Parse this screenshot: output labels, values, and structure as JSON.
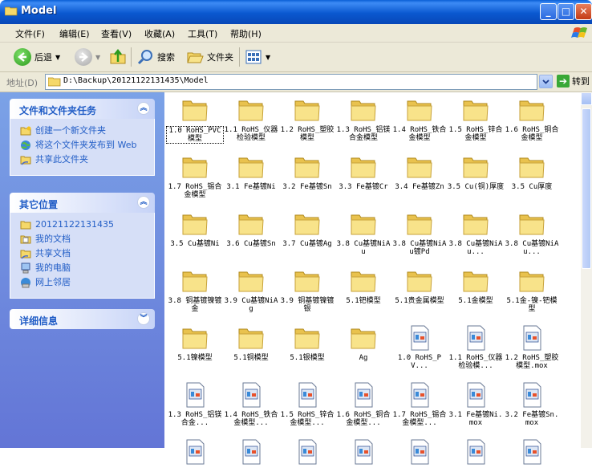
{
  "window": {
    "title": "Model"
  },
  "menu": {
    "items": [
      "文件(F)",
      "编辑(E)",
      "查看(V)",
      "收藏(A)",
      "工具(T)",
      "帮助(H)"
    ]
  },
  "toolbar": {
    "back_label": "后退",
    "search_label": "搜索",
    "folders_label": "文件夹"
  },
  "address": {
    "label": "地址(D)",
    "value": "D:\\Backup\\20121122131435\\Model",
    "goto_label": "转到"
  },
  "tasks_panel": {
    "title": "文件和文件夹任务",
    "items": [
      "创建一个新文件夹",
      "将这个文件夹发布到 Web",
      "共享此文件夹"
    ]
  },
  "places_panel": {
    "title": "其它位置",
    "items": [
      "20121122131435",
      "我的文档",
      "共享文档",
      "我的电脑",
      "网上邻居"
    ]
  },
  "details_panel": {
    "title": "详细信息"
  },
  "files": [
    {
      "label": "1.0 RoHS_PVC模型",
      "type": "folder"
    },
    {
      "label": "1.1 RoHS_仪器检验模型",
      "type": "folder"
    },
    {
      "label": "1.2 RoHS_塑胶模型",
      "type": "folder"
    },
    {
      "label": "1.3 RoHS_铝镁合金模型",
      "type": "folder"
    },
    {
      "label": "1.4 RoHS_铁合金模型",
      "type": "folder"
    },
    {
      "label": "1.5 RoHS_锌合金模型",
      "type": "folder"
    },
    {
      "label": "1.6 RoHS_铜合金模型",
      "type": "folder"
    },
    {
      "label": "1.7 RoHS_锡合金模型",
      "type": "folder"
    },
    {
      "label": "3.1 Fe基镀Ni",
      "type": "folder"
    },
    {
      "label": "3.2 Fe基镀Sn",
      "type": "folder"
    },
    {
      "label": "3.3 Fe基镀Cr",
      "type": "folder"
    },
    {
      "label": "3.4 Fe基镀Zn",
      "type": "folder"
    },
    {
      "label": "3.5 Cu(铜)厚度",
      "type": "folder"
    },
    {
      "label": "3.5 Cu厚度",
      "type": "folder"
    },
    {
      "label": "3.5 Cu基镀Ni",
      "type": "folder"
    },
    {
      "label": "3.6 Cu基镀Sn",
      "type": "folder"
    },
    {
      "label": "3.7 Cu基镀Ag",
      "type": "folder"
    },
    {
      "label": "3.8 Cu基镀NiAu",
      "type": "folder"
    },
    {
      "label": "3.8 Cu基镀NiAu镀Pd",
      "type": "folder"
    },
    {
      "label": "3.8 Cu基镀NiAu...",
      "type": "folder"
    },
    {
      "label": "3.8 Cu基镀NiAu...",
      "type": "folder"
    },
    {
      "label": "3.8 铜基镀镍镀金",
      "type": "folder"
    },
    {
      "label": "3.9 Cu基镀NiAg",
      "type": "folder"
    },
    {
      "label": "3.9 铜基镀镍镀银",
      "type": "folder"
    },
    {
      "label": "5.1钯模型",
      "type": "folder"
    },
    {
      "label": "5.1贵金属模型",
      "type": "folder"
    },
    {
      "label": "5.1金模型",
      "type": "folder"
    },
    {
      "label": "5.1金-镍-钯模型",
      "type": "folder"
    },
    {
      "label": "5.1镍模型",
      "type": "folder"
    },
    {
      "label": "5.1铜模型",
      "type": "folder"
    },
    {
      "label": "5.1银模型",
      "type": "folder"
    },
    {
      "label": "Ag",
      "type": "folder"
    },
    {
      "label": "1.0 RoHS_PV...",
      "type": "file"
    },
    {
      "label": "1.1 RoHS_仪器检验模...",
      "type": "file"
    },
    {
      "label": "1.2 RoHS_塑胶模型.mox",
      "type": "file"
    },
    {
      "label": "1.3 RoHS_铝镁合金...",
      "type": "file"
    },
    {
      "label": "1.4 RoHS_铁合金模型...",
      "type": "file"
    },
    {
      "label": "1.5 RoHS_锌合金模型...",
      "type": "file"
    },
    {
      "label": "1.6 RoHS_铜合金模型...",
      "type": "file"
    },
    {
      "label": "1.7 RoHS_锡合金模型...",
      "type": "file"
    },
    {
      "label": "3.1 Fe基镀Ni.mox",
      "type": "file"
    },
    {
      "label": "3.2 Fe基镀Sn.mox",
      "type": "file"
    },
    {
      "label": "",
      "type": "file"
    },
    {
      "label": "",
      "type": "file"
    },
    {
      "label": "",
      "type": "file"
    },
    {
      "label": "",
      "type": "file"
    },
    {
      "label": "",
      "type": "file"
    },
    {
      "label": "",
      "type": "file"
    },
    {
      "label": "",
      "type": "file"
    }
  ],
  "colors": {
    "titlebar": "#0a58d0",
    "task_link": "#215dc6",
    "folder": "#f5d86a"
  }
}
